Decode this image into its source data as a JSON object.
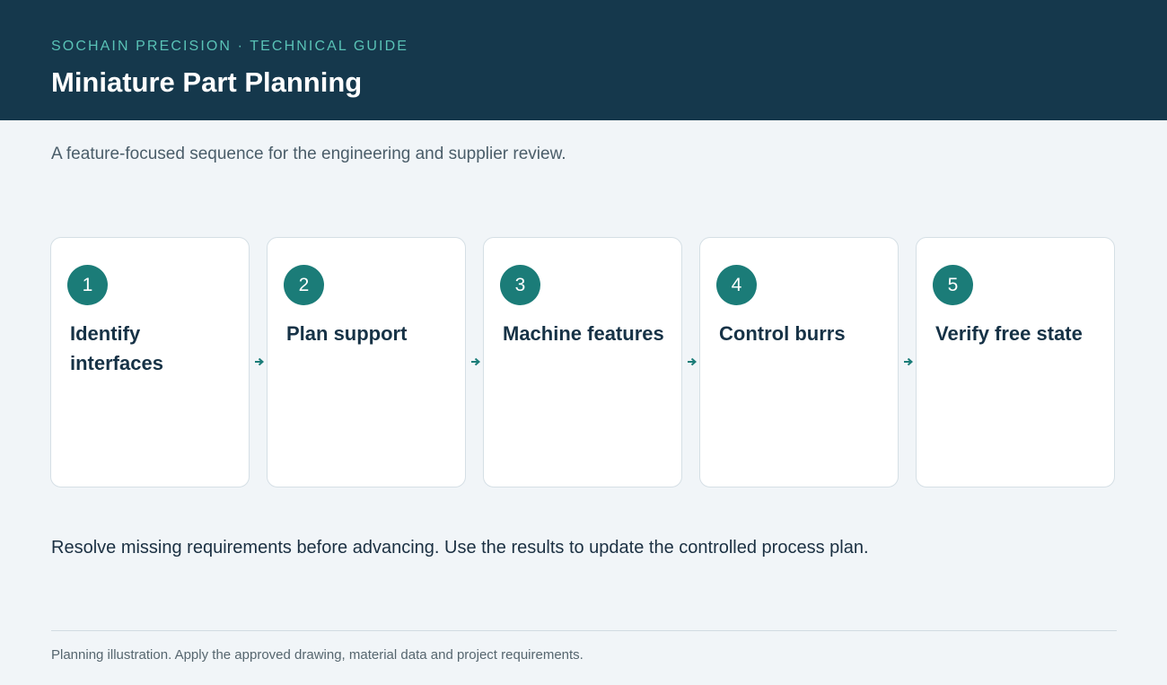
{
  "header": {
    "eyebrow": "SOCHAIN PRECISION · TECHNICAL GUIDE",
    "title": "Miniature Part Planning"
  },
  "subtitle": "A feature-focused sequence for the engineering and supplier review.",
  "steps": [
    {
      "number": "1",
      "label": "Identify interfaces"
    },
    {
      "number": "2",
      "label": "Plan support"
    },
    {
      "number": "3",
      "label": "Machine features"
    },
    {
      "number": "4",
      "label": "Control burrs"
    },
    {
      "number": "5",
      "label": "Verify free state"
    }
  ],
  "note": "Resolve missing requirements before advancing. Use the results to update the controlled process plan.",
  "footer": "Planning illustration. Apply the approved drawing, material data and project requirements.",
  "colors": {
    "header_bg": "#15384c",
    "accent": "#1b7c78",
    "eyebrow": "#59c2b6",
    "page_bg": "#f1f5f8"
  },
  "icons": {
    "connector": "arrow-right-icon"
  }
}
